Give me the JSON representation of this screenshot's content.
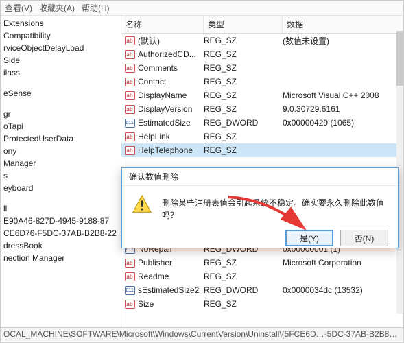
{
  "menubar": {
    "view": "查看(V)",
    "favorites": "收藏夹(A)",
    "help": "帮助(H)"
  },
  "tree": {
    "items": [
      "Extensions",
      "Compatibility",
      "rviceObjectDelayLoad",
      "Side",
      "ilass",
      "",
      "eSense",
      "",
      "gr",
      "oTapi",
      "ProtectedUserData",
      "ony",
      "Manager",
      "s",
      "eyboard",
      "",
      "ll",
      "E90A46-827D-4945-9188-87",
      "CE6D76-F5DC-37AB-B2B8-22",
      "dressBook",
      "nection Manager"
    ]
  },
  "columns": {
    "name": "名称",
    "type": "类型",
    "data": "数据"
  },
  "rows": [
    {
      "icon": "ab",
      "name": "(默认)",
      "type": "REG_SZ",
      "data": "(数值未设置)"
    },
    {
      "icon": "ab",
      "name": "AuthorizedCD...",
      "type": "REG_SZ",
      "data": ""
    },
    {
      "icon": "ab",
      "name": "Comments",
      "type": "REG_SZ",
      "data": ""
    },
    {
      "icon": "ab",
      "name": "Contact",
      "type": "REG_SZ",
      "data": ""
    },
    {
      "icon": "ab",
      "name": "DisplayName",
      "type": "REG_SZ",
      "data": "Microsoft Visual C++ 2008"
    },
    {
      "icon": "ab",
      "name": "DisplayVersion",
      "type": "REG_SZ",
      "data": "9.0.30729.6161"
    },
    {
      "icon": "dw",
      "name": "EstimatedSize",
      "type": "REG_DWORD",
      "data": "0x00000429 (1065)"
    },
    {
      "icon": "ab",
      "name": "HelpLink",
      "type": "REG_SZ",
      "data": ""
    },
    {
      "icon": "ab",
      "name": "HelpTelephone",
      "type": "REG_SZ",
      "data": "",
      "selected": true
    },
    {
      "icon": "dw",
      "name": "NoRepair",
      "type": "REG_DWORD",
      "data": "0x00000001 (1)"
    },
    {
      "icon": "ab",
      "name": "Publisher",
      "type": "REG_SZ",
      "data": "Microsoft Corporation"
    },
    {
      "icon": "ab",
      "name": "Readme",
      "type": "REG_SZ",
      "data": ""
    },
    {
      "icon": "dw",
      "name": "sEstimatedSize2",
      "type": "REG_DWORD",
      "data": "0x0000034dc (13532)"
    },
    {
      "icon": "ab",
      "name": "Size",
      "type": "REG_SZ",
      "data": ""
    }
  ],
  "dialog": {
    "title": "确认数值删除",
    "message": "删除某些注册表值会引起系统不稳定。确实要永久删除此数值吗？",
    "yes": "是(Y)",
    "no": "否(N)"
  },
  "statusbar": {
    "path": "OCAL_MACHINE\\SOFTWARE\\Microsoft\\Windows\\CurrentVersion\\Uninstall\\{5FCE6D…-5DC-37AB-B2B8…"
  },
  "icon_labels": {
    "ab": "ab",
    "dw": "011"
  }
}
